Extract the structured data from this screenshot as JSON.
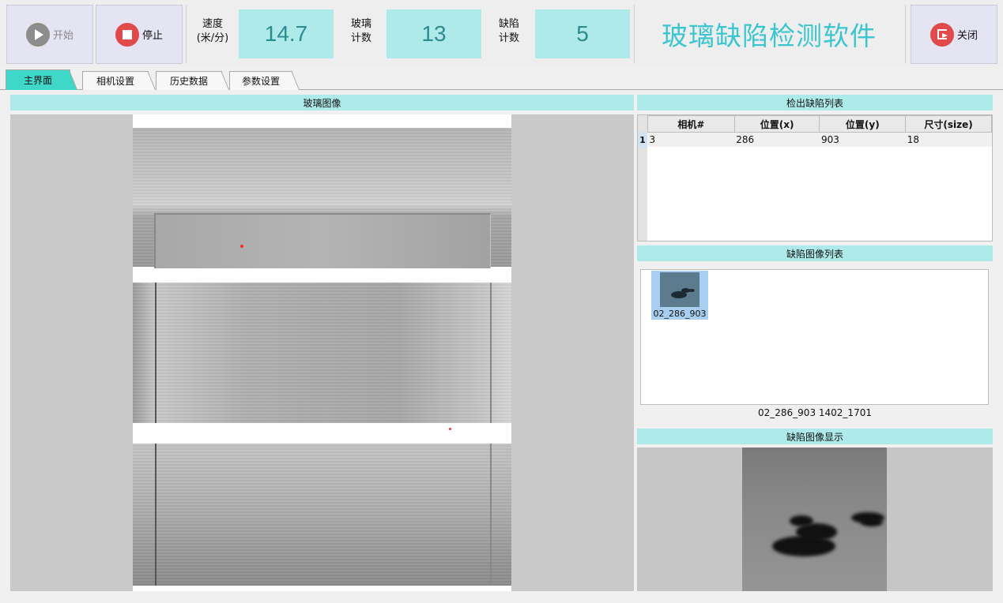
{
  "toolbar": {
    "start_label": "开始",
    "stop_label": "停止",
    "close_label": "关闭",
    "speed_label_line1": "速度",
    "speed_label_line2": "(米/分)",
    "speed_value": "14.7",
    "glass_label_line1": "玻璃",
    "glass_label_line2": "计数",
    "glass_count": "13",
    "defect_label_line1": "缺陷",
    "defect_label_line2": "计数",
    "defect_count": "5",
    "app_title": "玻璃缺陷检测软件"
  },
  "tabs": [
    {
      "label": "主界面",
      "active": true
    },
    {
      "label": "相机设置",
      "active": false
    },
    {
      "label": "历史数据",
      "active": false
    },
    {
      "label": "参数设置",
      "active": false
    }
  ],
  "glass_panel": {
    "title": "玻璃图像"
  },
  "defect_table": {
    "title": "检出缺陷列表",
    "columns": [
      "相机#",
      "位置(x)",
      "位置(y)",
      "尺寸(size)"
    ],
    "rows": [
      {
        "num": "1",
        "camera": "3",
        "x": "286",
        "y": "903",
        "size": "18"
      }
    ]
  },
  "image_list": {
    "title": "缺陷图像列表",
    "items": [
      {
        "label": "02_286_903"
      }
    ],
    "caption": "02_286_903 1402_1701"
  },
  "defect_display": {
    "title": "缺陷图像显示"
  },
  "colors": {
    "accent": "#3fd8c8",
    "header_bg": "#aeeaea",
    "title_text": "#3bc6cf",
    "stop_red": "#e04a4a"
  }
}
